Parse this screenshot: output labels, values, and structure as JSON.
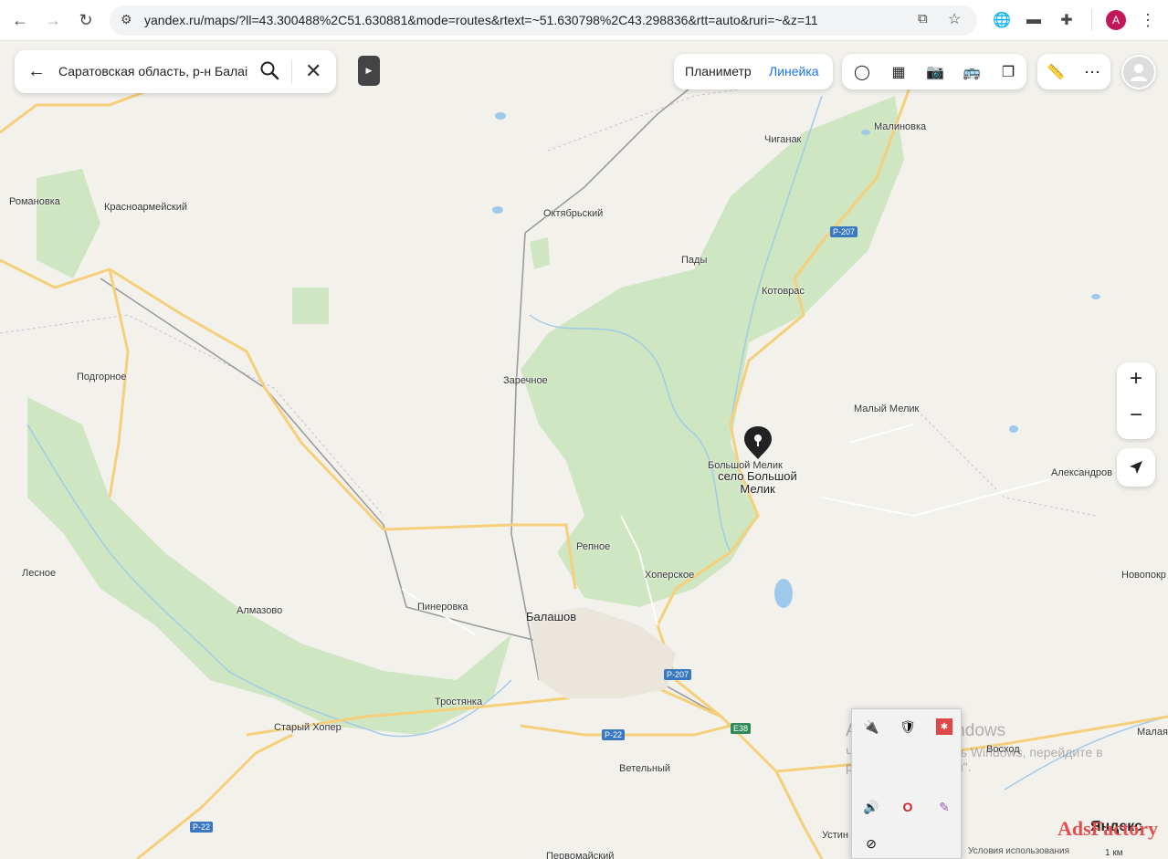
{
  "browser": {
    "url": "yandex.ru/maps/?ll=43.300488%2C51.630881&mode=routes&rtext=~51.630798%2C43.298836&rtt=auto&ruri=~&z=11",
    "profile_initial": "A"
  },
  "search": {
    "value": "Саратовская область, р-н Балаі"
  },
  "tools": {
    "planimeter": "Планиметр",
    "ruler": "Линейка"
  },
  "place_pin": {
    "label": "село Большой Мелик"
  },
  "map_labels": {
    "romanovka": "Романовка",
    "krasnoarmeisky": "Красноармейский",
    "oktyabrsky": "Октябрьский",
    "chiganak": "Чиганак",
    "malinovka": "Малиновка",
    "pady": "Пады",
    "kotovras": "Котоврас",
    "podgornoe": "Подгорное",
    "zarechnoe": "Заречное",
    "maly_melik": "Малый Мелик",
    "bolshoy_melik": "Большой Мелик",
    "aleksandrov": "Александров",
    "lesnoe": "Лесное",
    "repnoe": "Репное",
    "hoperskoe": "Хоперское",
    "novopokr": "Новопокр",
    "almazovo": "Алмазово",
    "pinerovka": "Пинеровка",
    "balashov": "Балашов",
    "trostyanka": "Тростянка",
    "stary_hoper": "Старый Хопер",
    "vetelny": "Ветельный",
    "voshod": "Восход",
    "malaya": "Малая",
    "pervomaisky": "Первомайский",
    "ustin": "Устин"
  },
  "road_badges": {
    "r207_top": "Р-207",
    "r207_mid": "Р-207",
    "r22_mid": "Р-22",
    "e38": "E38",
    "r22_left": "Р-22"
  },
  "windows_watermark": {
    "line1": "Активация Windows",
    "line2": "Чтобы активировать Windows, перейдите в",
    "line3": "раздел \"Параметры\"."
  },
  "map_footer": {
    "terms": "Условия использования",
    "scale": "1 км"
  },
  "brand": {
    "ads": "AdsFactory",
    "yandex": "Яндекс"
  },
  "colors": {
    "forest": "#cfe6c2",
    "road_major": "#f5cf7a",
    "water": "#9fc9ea",
    "accent_blue": "#1a73e8"
  }
}
